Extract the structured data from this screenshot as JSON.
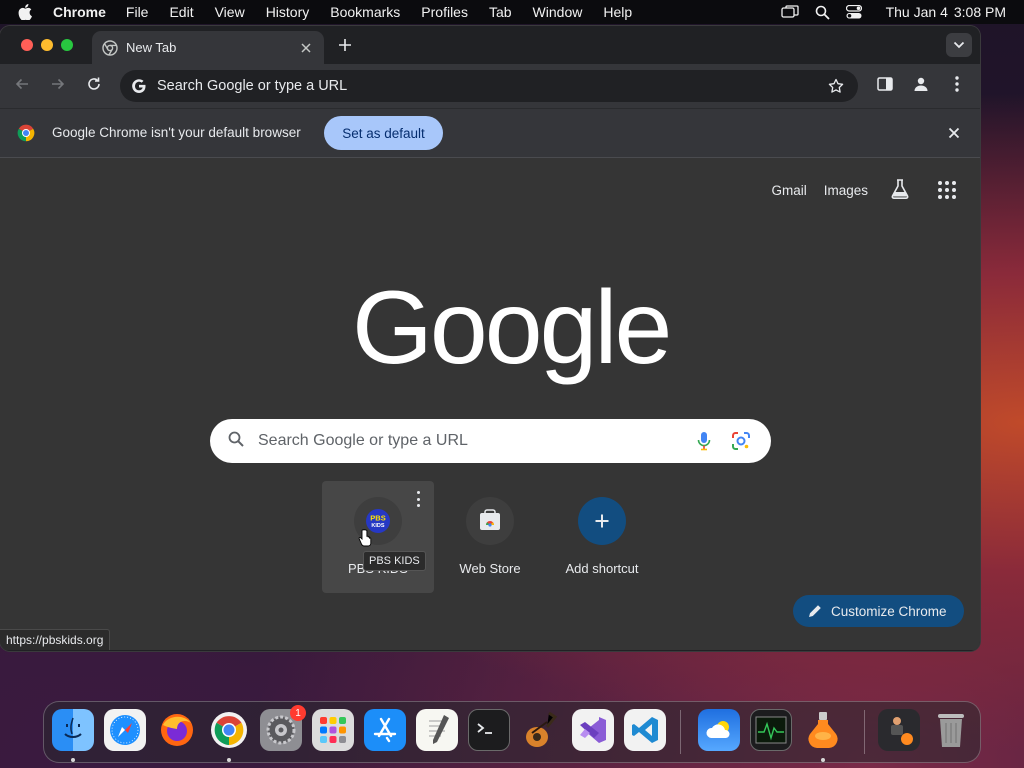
{
  "menubar": {
    "app_name": "Chrome",
    "items": [
      "File",
      "Edit",
      "View",
      "History",
      "Bookmarks",
      "Profiles",
      "Tab",
      "Window",
      "Help"
    ],
    "date": "Thu Jan 4",
    "time": "3:08 PM"
  },
  "tab": {
    "title": "New Tab"
  },
  "omnibox": {
    "placeholder": "Search Google or type a URL"
  },
  "infobar": {
    "message": "Google Chrome isn't your default browser",
    "button_label": "Set as default"
  },
  "ntp": {
    "top_links": {
      "gmail": "Gmail",
      "images": "Images"
    },
    "logo_text": "Google",
    "search_placeholder": "Search Google or type a URL",
    "shortcuts": [
      {
        "label": "PBS KIDS",
        "icon": "pbs-kids-icon",
        "tooltip": "PBS KIDS"
      },
      {
        "label": "Web Store",
        "icon": "web-store-icon"
      },
      {
        "label": "Add shortcut",
        "icon": "plus-icon"
      }
    ],
    "pbs_icon_text": "PBS KIDS",
    "customize_label": "Customize Chrome",
    "status_url": "https://pbskids.org"
  },
  "dock": {
    "apps": [
      "Finder",
      "Safari",
      "Firefox",
      "Chrome",
      "System Settings",
      "Launchpad",
      "App Store",
      "TextEdit",
      "Terminal",
      "GarageBand",
      "Visual Studio",
      "VS Code",
      "Weather",
      "Activity Monitor",
      "Potion",
      "Downloads",
      "Trash"
    ],
    "settings_badge": "1"
  },
  "colors": {
    "ntp_background": "#353535",
    "accent_button": "#a8c7fa",
    "customize_button": "#124d80"
  }
}
